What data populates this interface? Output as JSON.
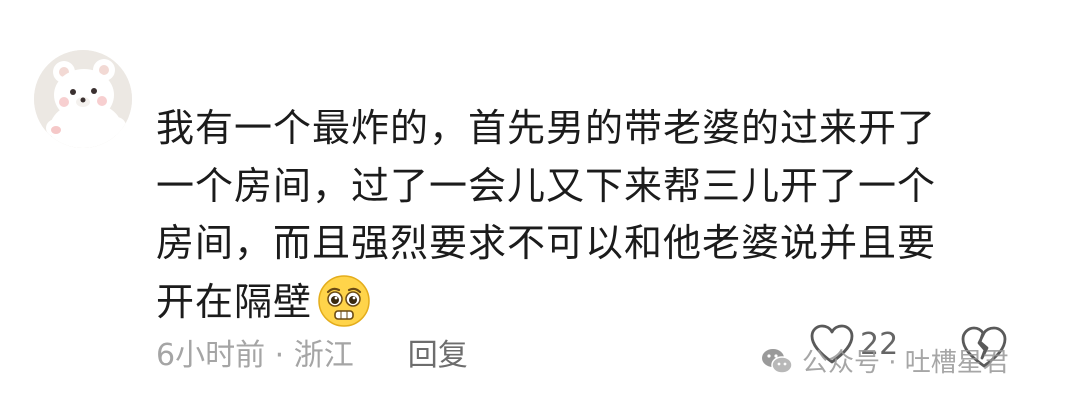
{
  "comment": {
    "avatar_icon": "plush-bear-avatar",
    "lines": [
      "我有一个最炸的，首先男的带老婆的过来开了",
      "一个房间，过了一会儿又下来帮三儿开了一个",
      "房间，而且强烈要求不可以和他老婆说并且要",
      "开在隔壁"
    ],
    "emoji_icon": "pleading-face-emoji",
    "time_location": "6小时前 · 浙江",
    "reply_label": "回复",
    "like_count": "22"
  },
  "watermark": {
    "logo_icon": "wechat-icon",
    "text": "公众号 · 吐槽星君"
  }
}
